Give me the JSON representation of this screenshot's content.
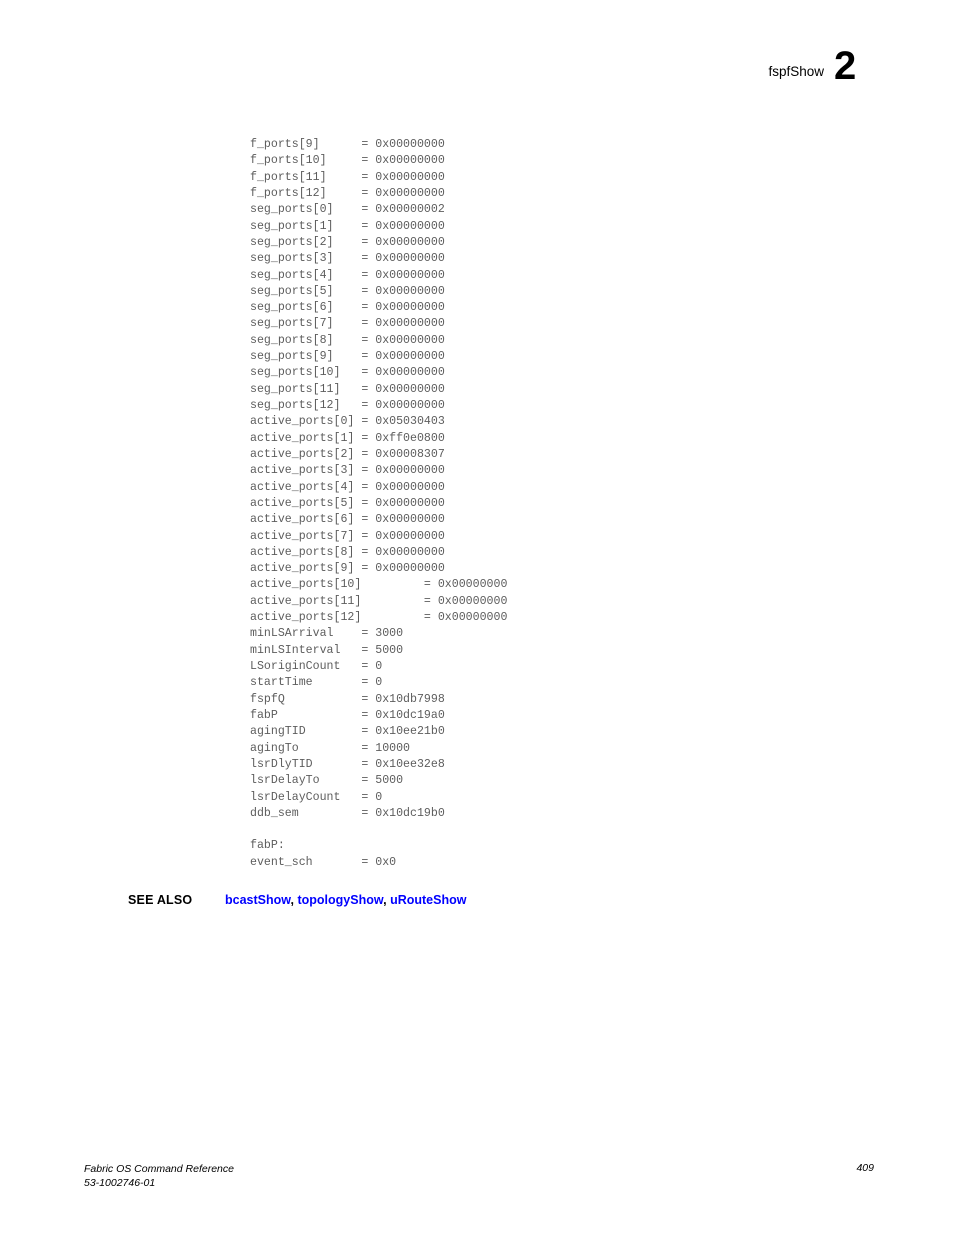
{
  "header": {
    "title": "fspfShow",
    "chapter": "2"
  },
  "code": {
    "lines": [
      "f_ports[9]      = 0x00000000",
      "f_ports[10]     = 0x00000000",
      "f_ports[11]     = 0x00000000",
      "f_ports[12]     = 0x00000000",
      "seg_ports[0]    = 0x00000002",
      "seg_ports[1]    = 0x00000000",
      "seg_ports[2]    = 0x00000000",
      "seg_ports[3]    = 0x00000000",
      "seg_ports[4]    = 0x00000000",
      "seg_ports[5]    = 0x00000000",
      "seg_ports[6]    = 0x00000000",
      "seg_ports[7]    = 0x00000000",
      "seg_ports[8]    = 0x00000000",
      "seg_ports[9]    = 0x00000000",
      "seg_ports[10]   = 0x00000000",
      "seg_ports[11]   = 0x00000000",
      "seg_ports[12]   = 0x00000000",
      "active_ports[0] = 0x05030403",
      "active_ports[1] = 0xff0e0800",
      "active_ports[2] = 0x00008307",
      "active_ports[3] = 0x00000000",
      "active_ports[4] = 0x00000000",
      "active_ports[5] = 0x00000000",
      "active_ports[6] = 0x00000000",
      "active_ports[7] = 0x00000000",
      "active_ports[8] = 0x00000000",
      "active_ports[9] = 0x00000000",
      "active_ports[10]         = 0x00000000",
      "active_ports[11]         = 0x00000000",
      "active_ports[12]         = 0x00000000",
      "minLSArrival    = 3000",
      "minLSInterval   = 5000",
      "LSoriginCount   = 0",
      "startTime       = 0",
      "fspfQ           = 0x10db7998",
      "fabP            = 0x10dc19a0",
      "agingTID        = 0x10ee21b0",
      "agingTo         = 10000",
      "lsrDlyTID       = 0x10ee32e8",
      "lsrDelayTo      = 5000",
      "lsrDelayCount   = 0",
      "ddb_sem         = 0x10dc19b0",
      "",
      "fabP:",
      "event_sch       = 0x0"
    ]
  },
  "see_also": {
    "label": "SEE ALSO",
    "links": [
      "bcastShow",
      "topologyShow",
      "uRouteShow"
    ],
    "separator": ", ",
    "link_color": "#0000ff"
  },
  "footer": {
    "title": "Fabric OS Command Reference",
    "doc_number": "53-1002746-01",
    "page_number": "409"
  }
}
